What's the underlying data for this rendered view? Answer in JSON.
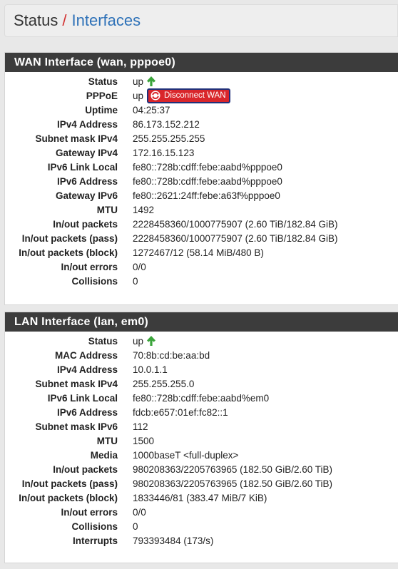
{
  "breadcrumb": {
    "root": "Status",
    "separator": "/",
    "current": "Interfaces"
  },
  "colors": {
    "header_bg": "#3c3c3c",
    "link": "#2f72b8",
    "separator": "#d23030",
    "up_arrow": "#3aa43a",
    "button_bg": "#d9262b"
  },
  "wan": {
    "title": "WAN Interface (wan, pppoe0)",
    "disconnect_label": "Disconnect WAN",
    "rows": [
      {
        "label": "Status",
        "value": "up"
      },
      {
        "label": "PPPoE",
        "value": "up"
      },
      {
        "label": "Uptime",
        "value": "04:25:37"
      },
      {
        "label": "IPv4 Address",
        "value": "86.173.152.212"
      },
      {
        "label": "Subnet mask IPv4",
        "value": "255.255.255.255"
      },
      {
        "label": "Gateway IPv4",
        "value": "172.16.15.123"
      },
      {
        "label": "IPv6 Link Local",
        "value": "fe80::728b:cdff:febe:aabd%pppoe0"
      },
      {
        "label": "IPv6 Address",
        "value": "fe80::728b:cdff:febe:aabd%pppoe0"
      },
      {
        "label": "Gateway IPv6",
        "value": "fe80::2621:24ff:febe:a63f%pppoe0"
      },
      {
        "label": "MTU",
        "value": "1492"
      },
      {
        "label": "In/out packets",
        "value": "2228458360/1000775907 (2.60 TiB/182.84 GiB)"
      },
      {
        "label": "In/out packets (pass)",
        "value": "2228458360/1000775907 (2.60 TiB/182.84 GiB)"
      },
      {
        "label": "In/out packets (block)",
        "value": "1272467/12 (58.14 MiB/480 B)"
      },
      {
        "label": "In/out errors",
        "value": "0/0"
      },
      {
        "label": "Collisions",
        "value": "0"
      }
    ]
  },
  "lan": {
    "title": "LAN Interface (lan, em0)",
    "rows": [
      {
        "label": "Status",
        "value": "up"
      },
      {
        "label": "MAC Address",
        "value": "70:8b:cd:be:aa:bd"
      },
      {
        "label": "IPv4 Address",
        "value": "10.0.1.1"
      },
      {
        "label": "Subnet mask IPv4",
        "value": "255.255.255.0"
      },
      {
        "label": "IPv6 Link Local",
        "value": "fe80::728b:cdff:febe:aabd%em0"
      },
      {
        "label": "IPv6 Address",
        "value": "fdcb:e657:01ef:fc82::1"
      },
      {
        "label": "Subnet mask IPv6",
        "value": "112"
      },
      {
        "label": "MTU",
        "value": "1500"
      },
      {
        "label": "Media",
        "value": "1000baseT <full-duplex>"
      },
      {
        "label": "In/out packets",
        "value": "980208363/2205763965 (182.50 GiB/2.60 TiB)"
      },
      {
        "label": "In/out packets (pass)",
        "value": "980208363/2205763965 (182.50 GiB/2.60 TiB)"
      },
      {
        "label": "In/out packets (block)",
        "value": "1833446/81 (383.47 MiB/7 KiB)"
      },
      {
        "label": "In/out errors",
        "value": "0/0"
      },
      {
        "label": "Collisions",
        "value": "0"
      },
      {
        "label": "Interrupts",
        "value": "793393484 (173/s)"
      }
    ]
  }
}
